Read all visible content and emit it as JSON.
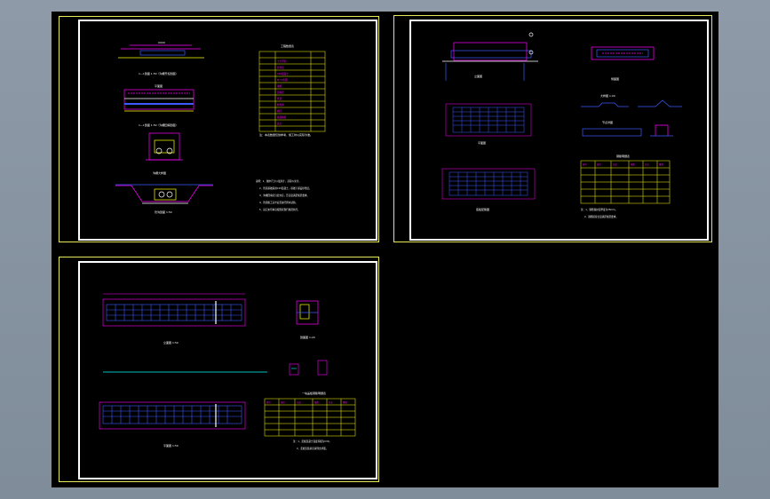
{
  "sheet1": {
    "label_section_1": "1—1剖面 1:50（沟槽开挖剖面）",
    "label_plan": "平面图",
    "label_section_2": "1—1剖面 1:50（沟槽回填剖面）",
    "label_detail": "沟槽大样图",
    "label_trench": "管沟剖面 1:50",
    "table_title": "工程数量表",
    "table_rows": [
      "土方开挖",
      "砂垫层",
      "C15混凝土",
      "M7.5浆砌",
      "钢筋",
      "回填土",
      "管道",
      "检查井",
      "阀门",
      "路面恢复",
      "其它"
    ],
    "table_note": "注：本表数量仅供参考，施工时以实际为准。",
    "notes": [
      "说明：1、图中尺寸以毫米计，高程以米计。",
      "2、管道基础采用C15混凝土，基础下铺设砂垫层。",
      "3、沟槽回填应分层夯实，压实度满足规范要求。",
      "4、管道施工完毕后须进行闭水试验。",
      "5、其它未尽事宜按国家现行规范执行。"
    ]
  },
  "sheet2": {
    "label_elevation": "立面图",
    "label_plan": "平面图",
    "label_section": "底板配筋图",
    "label_side": "侧面图",
    "label_detail_a": "大样图 1:20",
    "label_detail_b": "节点详图",
    "table_title": "钢筋明细表",
    "table_header": [
      "编号",
      "直径",
      "长度",
      "根数",
      "总长",
      "重量"
    ],
    "notes": [
      "注：1、钢筋保护层厚度为35mm。",
      "2、钢筋搭接长度满足规范要求。"
    ]
  },
  "sheet3": {
    "label_elevation": "立面图 1:50",
    "label_detail": "剖面图 1:20",
    "label_plan": "平面图 1:50",
    "table_title": "一块盖板钢筋明细表",
    "table_header": [
      "编号",
      "直径",
      "长度",
      "根数",
      "总长",
      "重量"
    ],
    "notes": [
      "注：1、盖板混凝土强度等级为C30。",
      "2、盖板安装前应清理支承面。"
    ]
  },
  "colors": {
    "magenta": "#ff00ff",
    "cyan": "#00ffff",
    "blue": "#3c5aff",
    "yellow": "#ffff00",
    "white": "#ffffff",
    "green": "#00ff00",
    "red": "#ff3030"
  }
}
